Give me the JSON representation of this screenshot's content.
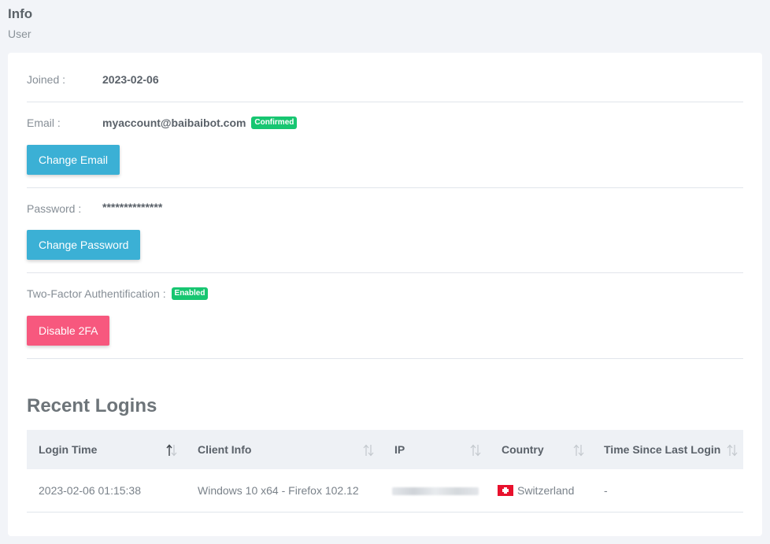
{
  "header": {
    "title": "Info",
    "subtitle": "User"
  },
  "joined": {
    "label": "Joined :",
    "value": "2023-02-06"
  },
  "email": {
    "label": "Email :",
    "value": "myaccount@baibaibot.com",
    "badge": "Confirmed",
    "button_label": "Change Email"
  },
  "password": {
    "label": "Password :",
    "value": "**************",
    "button_label": "Change Password"
  },
  "two_factor": {
    "label": "Two-Factor Authentification :",
    "badge": "Enabled",
    "button_label": "Disable 2FA"
  },
  "recent_logins": {
    "title": "Recent Logins",
    "columns": [
      {
        "label": "Login Time",
        "sort_icon": "sort-asc-icon"
      },
      {
        "label": "Client Info",
        "sort_icon": "sort-icon"
      },
      {
        "label": "IP",
        "sort_icon": "sort-icon"
      },
      {
        "label": "Country",
        "sort_icon": "sort-icon"
      },
      {
        "label": "Time Since Last Login",
        "sort_icon": "sort-icon"
      }
    ],
    "rows": [
      {
        "login_time": "2023-02-06 01:15:38",
        "client_info": "Windows 10 x64 - Firefox 102.12",
        "ip": "",
        "country": "Switzerland",
        "country_flag": "swiss-flag-icon",
        "time_since_last_login": "-"
      }
    ]
  },
  "colors": {
    "badge_green": "#17c671",
    "button_info": "#3bb0d5",
    "button_danger": "#f7587e"
  }
}
